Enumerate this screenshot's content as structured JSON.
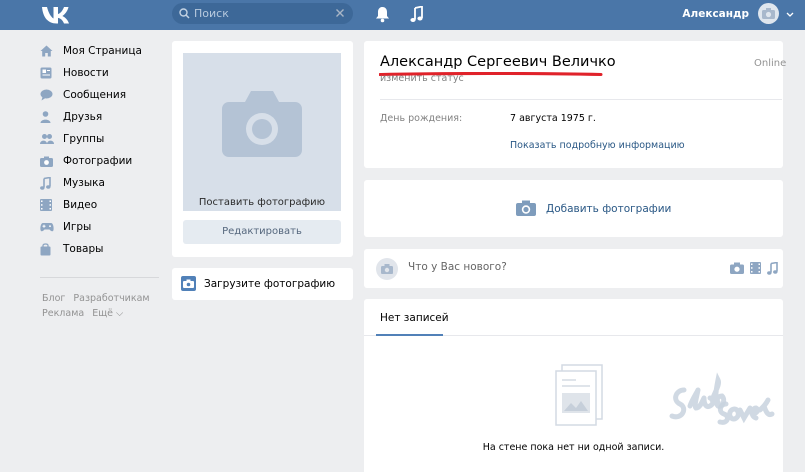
{
  "header": {
    "logo_icon": "vk-logo-icon",
    "search_placeholder": "Поиск",
    "user_name": "Александр"
  },
  "sidebar": {
    "items": [
      {
        "label": "Моя Страница",
        "icon": "home-icon"
      },
      {
        "label": "Новости",
        "icon": "news-icon"
      },
      {
        "label": "Сообщения",
        "icon": "messages-icon"
      },
      {
        "label": "Друзья",
        "icon": "friend-icon"
      },
      {
        "label": "Группы",
        "icon": "groups-icon"
      },
      {
        "label": "Фотографии",
        "icon": "photo-icon"
      },
      {
        "label": "Музыка",
        "icon": "music-icon"
      },
      {
        "label": "Видео",
        "icon": "video-icon"
      },
      {
        "label": "Игры",
        "icon": "games-icon"
      },
      {
        "label": "Товары",
        "icon": "goods-icon"
      }
    ],
    "footer": {
      "blog": "Блог",
      "developers": "Разработчикам",
      "ads": "Реклама",
      "more": "Ещё ⌵"
    }
  },
  "photo": {
    "set_photo_label": "Поставить фотографию",
    "edit_label": "Редактировать",
    "upload_prompt": "Загрузите фотографию"
  },
  "profile": {
    "name": "Александр Сергеевич Величко",
    "status_link": "изменить статус",
    "online": "Online",
    "birthday_label": "День рождения:",
    "birthday_value": "7 августа 1975 г.",
    "more_info": "Показать подробную информацию"
  },
  "add_photos": {
    "label": "Добавить фотографии"
  },
  "post": {
    "placeholder": "Что у Вас нового?"
  },
  "wall": {
    "tab": "Нет записей",
    "empty_text": "На стене пока нет ни одной записи."
  },
  "colors": {
    "header": "#4a76a8",
    "accent": "#5181b8",
    "link": "#2a5885",
    "background": "#edeef0",
    "underline": "#e0222a"
  }
}
